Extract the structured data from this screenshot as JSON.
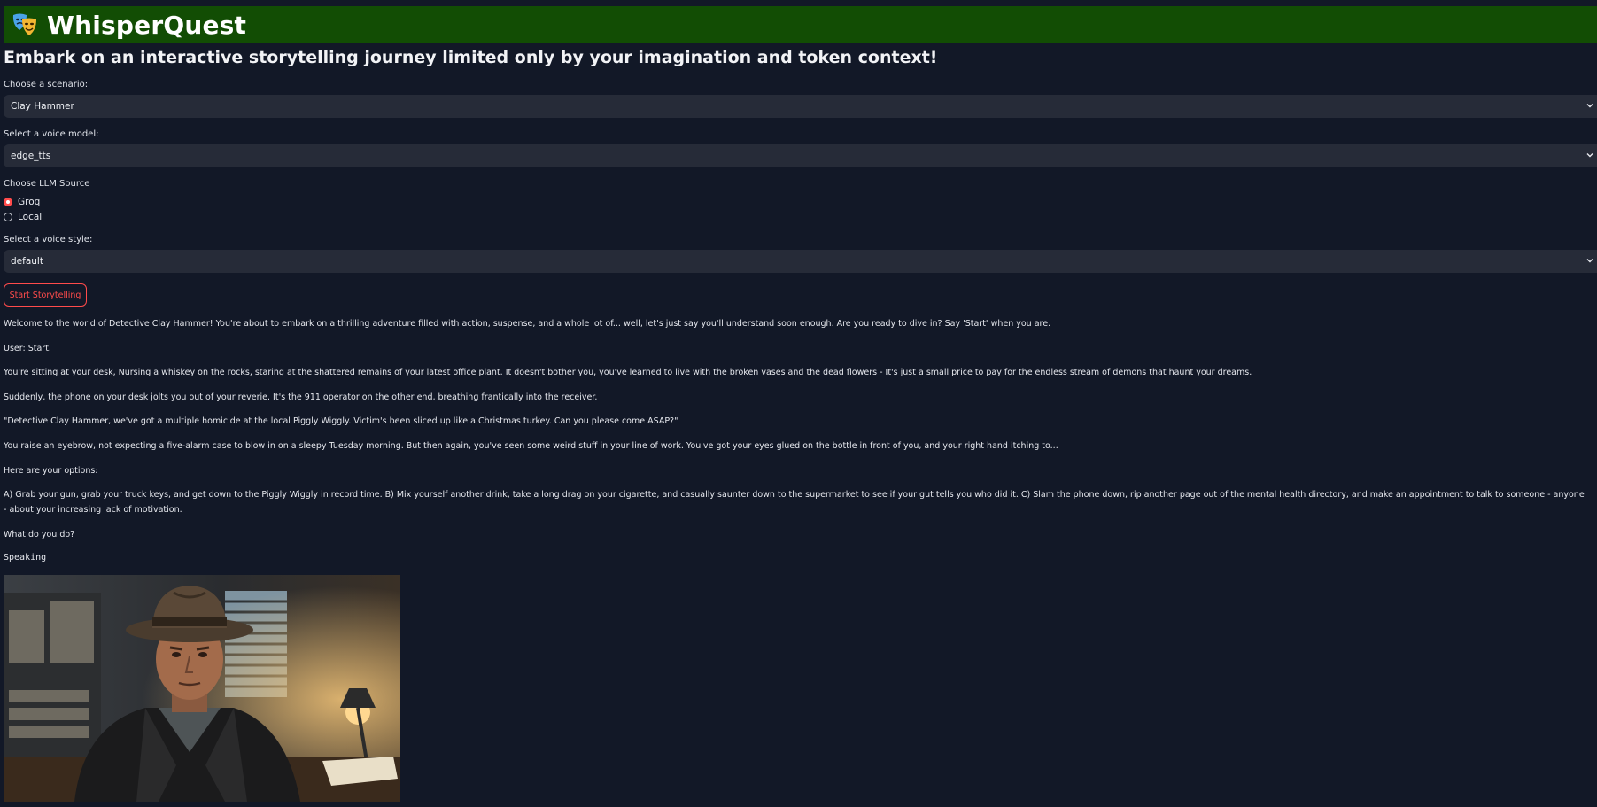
{
  "app": {
    "title": "WhisperQuest",
    "logo_icon": "theater-masks-icon",
    "subtitle": "Embark on an interactive storytelling journey limited only by your imagination and token context!"
  },
  "scenario": {
    "label": "Choose a scenario:",
    "value": "Clay Hammer"
  },
  "voice_model": {
    "label": "Select a voice model:",
    "value": "edge_tts"
  },
  "llm_source": {
    "label": "Choose LLM Source",
    "options": [
      {
        "label": "Groq",
        "selected": true
      },
      {
        "label": "Local",
        "selected": false
      }
    ]
  },
  "voice_style": {
    "label": "Select a voice style:",
    "value": "default"
  },
  "start_button": {
    "label": "Start Storytelling"
  },
  "story": [
    "Welcome to the world of Detective Clay Hammer! You're about to embark on a thrilling adventure filled with action, suspense, and a whole lot of... well, let's just say you'll understand soon enough. Are you ready to dive in? Say 'Start' when you are.",
    "User: Start.",
    "You're sitting at your desk, Nursing a whiskey on the rocks, staring at the shattered remains of your latest office plant. It doesn't bother you, you've learned to live with the broken vases and the dead flowers - It's just a small price to pay for the endless stream of demons that haunt your dreams.",
    "Suddenly, the phone on your desk jolts you out of your reverie. It's the 911 operator on the other end, breathing frantically into the receiver.",
    "\"Detective Clay Hammer, we've got a multiple homicide at the local Piggly Wiggly. Victim's been sliced up like a Christmas turkey. Can you please come ASAP?\"",
    "You raise an eyebrow, not expecting a five-alarm case to blow in on a sleepy Tuesday morning. But then again, you've seen some weird stuff in your line of work. You've got your eyes glued on the bottle in front of you, and your right hand itching to...",
    "Here are your options:",
    "A) Grab your gun, grab your truck keys, and get down to the Piggly Wiggly in record time. B) Mix yourself another drink, take a long drag on your cigarette, and casually saunter down to the supermarket to see if your gut tells you who did it. C) Slam the phone down, rip another page out of the mental health directory, and make an appointment to talk to someone - anyone - about your increasing lack of motivation.",
    "What do you do?"
  ],
  "status": {
    "speaking": "Speaking"
  },
  "colors": {
    "background": "#121827",
    "banner": "#124d04",
    "accent": "#ff4b4b",
    "input_bg": "#262b38"
  }
}
